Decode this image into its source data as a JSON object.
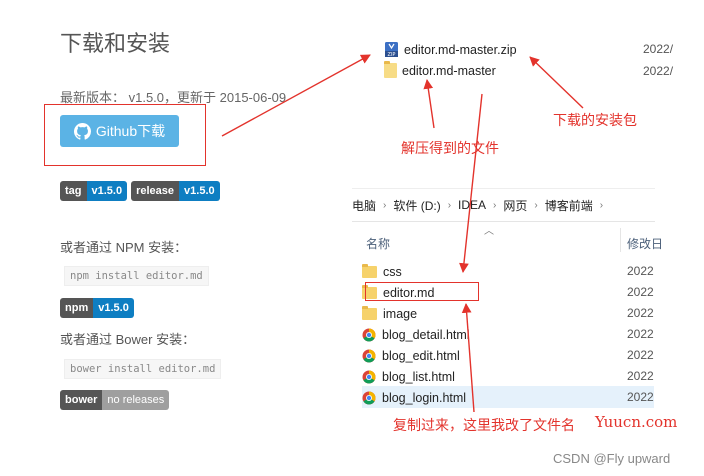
{
  "left_panel": {
    "title": "下载和安装",
    "latest_version": "最新版本：  v1.5.0，更新于 2015-06-09",
    "github_button": "Github下载",
    "badges": [
      {
        "key": "tag",
        "value": "v1.5.0"
      },
      {
        "key": "release",
        "value": "v1.5.0"
      }
    ],
    "npm_label": "或者通过 NPM 安装：",
    "npm_command": "npm install editor.md",
    "npm_badge": {
      "key": "npm",
      "value": "v1.5.0"
    },
    "bower_label": "或者通过 Bower 安装：",
    "bower_command": "bower install editor.md",
    "bower_badge": {
      "key": "bower",
      "value": "no releases"
    }
  },
  "zip_listing": {
    "items": [
      {
        "name": "editor.md-master.zip",
        "date": "2022/",
        "icon": "zip-icon"
      },
      {
        "name": "editor.md-master",
        "date": "2022/",
        "icon": "folder-icon"
      }
    ]
  },
  "explorer": {
    "breadcrumb": [
      "电脑",
      "软件 (D:)",
      "IDEA",
      "网页",
      "博客前端"
    ],
    "columns": {
      "name": "名称",
      "modified": "修改日"
    },
    "files": [
      {
        "name": "css",
        "type": "folder",
        "date": "2022"
      },
      {
        "name": "editor.md",
        "type": "folder",
        "date": "2022"
      },
      {
        "name": "image",
        "type": "folder",
        "date": "2022"
      },
      {
        "name": "blog_detail.html",
        "type": "chrome",
        "date": "2022"
      },
      {
        "name": "blog_edit.html",
        "type": "chrome",
        "date": "2022"
      },
      {
        "name": "blog_list.html",
        "type": "chrome",
        "date": "2022"
      },
      {
        "name": "blog_login.html",
        "type": "chrome",
        "date": "2022"
      }
    ]
  },
  "annotations": {
    "installer": "下载的安装包",
    "extracted": "解压得到的文件",
    "renamed": "复制过来，这里我改了文件名"
  },
  "watermarks": {
    "site": "Yuucn.com",
    "csdn": "CSDN @Fly upward"
  },
  "colors": {
    "accent_red": "#e3332c",
    "github_button": "#5bb3e5",
    "badge_key": "#555555",
    "badge_value": "#0e7ec2"
  }
}
